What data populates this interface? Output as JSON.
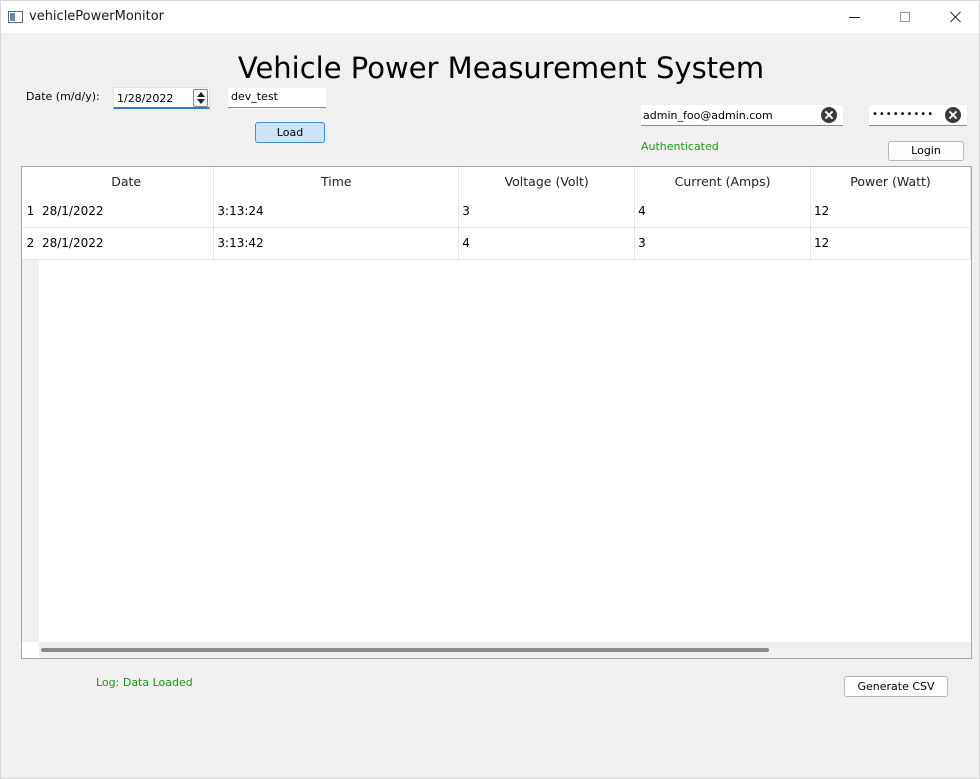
{
  "window": {
    "title": "vehiclePowerMonitor"
  },
  "header": {
    "title": "Vehicle Power Measurement System"
  },
  "controls": {
    "date_label": "Date (m/d/y):",
    "date_value": "1/28/2022",
    "database_value": "dev_test",
    "load_label": "Load"
  },
  "auth": {
    "email_value": "admin_foo@admin.com",
    "password_mask": "•••••••••",
    "status": "Authenticated",
    "login_label": "Login"
  },
  "table": {
    "columns": [
      "Date",
      "Time",
      "Voltage (Volt)",
      "Current (Amps)",
      "Power (Watt)"
    ],
    "rows": [
      {
        "num": "1",
        "cells": [
          "28/1/2022",
          "3:13:24",
          "3",
          "4",
          "12"
        ]
      },
      {
        "num": "2",
        "cells": [
          "28/1/2022",
          "3:13:42",
          "4",
          "3",
          "12"
        ]
      }
    ]
  },
  "footer": {
    "log": "Log: Data Loaded",
    "csv_label": "Generate CSV"
  },
  "colors": {
    "status_green": "#1a9a1a",
    "accent_blue": "#3f8fd8"
  }
}
